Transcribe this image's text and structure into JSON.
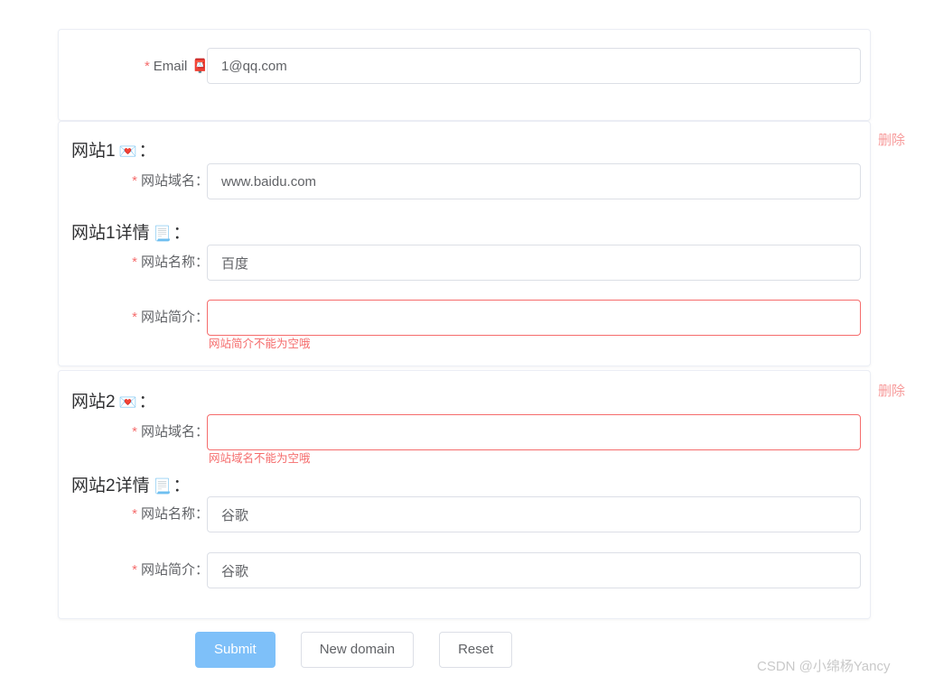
{
  "form": {
    "email_row": {
      "label": "Email",
      "icon": "postbox-icon",
      "icon_glyph": "📮",
      "required_mark": "*",
      "value": "1@qq.com",
      "placeholder": ""
    },
    "sites": [
      {
        "heading": "网站1",
        "heading_icon": "love-letter-icon",
        "heading_icon_glyph": "💌",
        "heading_suffix": "：",
        "delete_label": "删除",
        "domain_row": {
          "label": "网站域名：",
          "required_mark": "*",
          "value": "www.baidu.com",
          "placeholder": "",
          "error": ""
        },
        "detail_heading": "网站1详情",
        "detail_heading_icon": "page-icon",
        "detail_heading_icon_glyph": "📃",
        "detail_heading_suffix": "：",
        "name_row": {
          "label": "网站名称：",
          "required_mark": "*",
          "value": "百度",
          "placeholder": "",
          "error": ""
        },
        "intro_row": {
          "label": "网站简介：",
          "required_mark": "*",
          "value": "",
          "placeholder": "",
          "error": "网站简介不能为空哦"
        }
      },
      {
        "heading": "网站2",
        "heading_icon": "love-letter-icon",
        "heading_icon_glyph": "💌",
        "heading_suffix": "：",
        "delete_label": "删除",
        "domain_row": {
          "label": "网站域名：",
          "required_mark": "*",
          "value": "",
          "placeholder": "",
          "error": "网站域名不能为空哦"
        },
        "detail_heading": "网站2详情",
        "detail_heading_icon": "page-icon",
        "detail_heading_icon_glyph": "📃",
        "detail_heading_suffix": "：",
        "name_row": {
          "label": "网站名称：",
          "required_mark": "*",
          "value": "谷歌",
          "placeholder": "",
          "error": ""
        },
        "intro_row": {
          "label": "网站简介：",
          "required_mark": "*",
          "value": "谷歌",
          "placeholder": "",
          "error": ""
        }
      }
    ]
  },
  "buttons": {
    "submit": "Submit",
    "new_domain": "New domain",
    "reset": "Reset"
  },
  "watermark": "CSDN @小绵杨Yancy",
  "colors": {
    "primary": "#7ec0f9",
    "danger": "#f56c6c",
    "delete_link": "#f79a9a",
    "label": "#606266",
    "border": "#dcdfe6",
    "card_border": "#ebeef5"
  }
}
